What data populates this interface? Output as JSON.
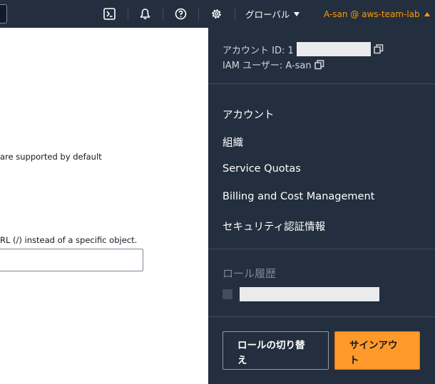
{
  "topbar": {
    "cloudshell_icon": "terminal-icon",
    "notifications_icon": "bell-icon",
    "help_icon": "question-circle-icon",
    "settings_icon": "gear-icon",
    "region_label": "グローバル",
    "account_label": "A-san @ aws-team-lab",
    "account_color": "#ff9900"
  },
  "background": {
    "line1": "are supported by default",
    "line2": "RL (/) instead of a specific object."
  },
  "account_menu": {
    "account_id_label": "アカウント ID: 1",
    "iam_user_label": "IAM ユーザー: A-san",
    "items": [
      {
        "label": "アカウント"
      },
      {
        "label": "組織"
      },
      {
        "label": "Service Quotas"
      },
      {
        "label": "Billing and Cost Management"
      },
      {
        "label": "セキュリティ認証情報"
      }
    ],
    "role_history_title": "ロール履歴",
    "switch_role_line1": "ロールの切り替",
    "switch_role_line2": "え",
    "sign_out_line1": "サインアウ",
    "sign_out_line2": "ト",
    "primary_color": "#ff9a2a"
  }
}
